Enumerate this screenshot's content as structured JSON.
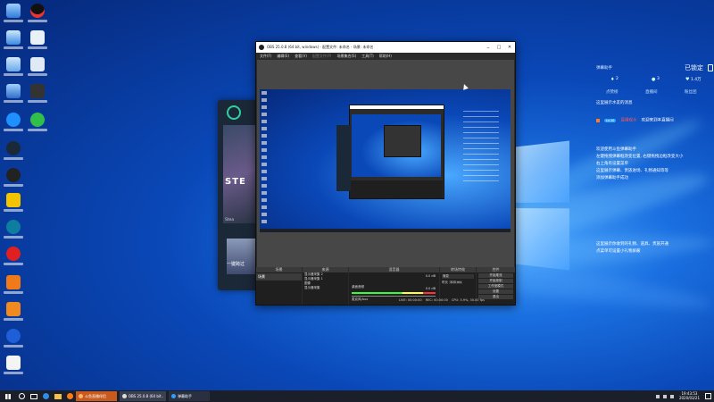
{
  "obs": {
    "title": "OBS 25.0.8 (64 bit, windows) - 配置文件: 未命名 - 场景: 未命名",
    "menu": [
      "文件(F)",
      "编辑(E)",
      "查看(V)",
      "配置文件(P)",
      "场景集合(S)",
      "工具(T)",
      "帮助(H)"
    ],
    "docks": {
      "scenes": "场景",
      "sources": "来源",
      "mixer": "混音器",
      "transitions": "转场特效",
      "controls": "控件"
    },
    "scene_item": "场景",
    "sources_list": [
      "显示器采集 2",
      "显示器采集 1",
      "图像",
      "显示器采集"
    ],
    "mixer_tracks": [
      "桌面音频",
      "麦克风/Aux"
    ],
    "mixer_db": [
      "0.0 dB",
      "0.0 dB"
    ],
    "transition_value": "渐变",
    "duration_label": "时长",
    "duration_value": "300 ms",
    "controls_buttons": [
      "开始推流",
      "开始录制",
      "工作室模式",
      "设置",
      "退出"
    ],
    "status": [
      "LIVE: 00:00:00",
      "REC: 00:00:00",
      "CPU: 3.9%, 30.00 fps"
    ]
  },
  "overlay": {
    "header": "弹幕助手",
    "locked": "已锁定",
    "counts": [
      "2",
      "3",
      "1.4万"
    ],
    "tabs": [
      "点赞榜",
      "直播间",
      "粉丝团"
    ],
    "notice": "这里展示水友的消息",
    "user_level": "Lv.10",
    "user_name": "直播观众",
    "welcome": "欢迎来到本直播间",
    "tips": [
      "欢迎使用斗鱼弹幕助手",
      "左键拖拽弹幕框改变位置, 右键拖拽边框改变大小",
      "右上角有设置菜单",
      "这里展示弹幕、贵族进场、礼物通知等等",
      "添加弹幕助手成功"
    ],
    "tip2": [
      "这里展示你收到的礼物、道具、贵族开通",
      "点菜单可设置小礼物屏蔽"
    ]
  },
  "steam": {
    "logo": "STE",
    "sub": "Stea",
    "promo": "一键跨过"
  },
  "taskbar": {
    "items": [
      "斗鱼直播伴侣",
      "OBS 25.0.8 (64 bit...",
      "弹幕助手"
    ],
    "time": "19:43:53",
    "date": "2020/03/21"
  },
  "colors": {
    "accent": "#2ea0ff",
    "desktop_dark": "#06287a",
    "obs_bg": "#2b2b2b",
    "locked_color": "#ffffff"
  }
}
